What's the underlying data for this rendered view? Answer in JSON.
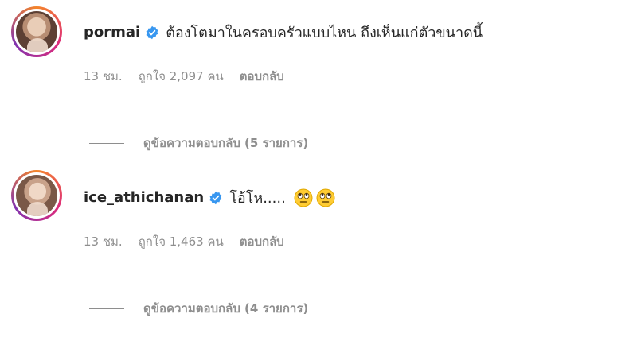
{
  "comments": [
    {
      "username": "pormai",
      "text": "ต้องโตมาในครอบครัวแบบไหน ถึงเห็นแก่ตัวขนาดนี้",
      "time": "13 ชม.",
      "likes": "ถูกใจ 2,097 คน",
      "reply": "ตอบกลับ",
      "view_replies": "ดูข้อความตอบกลับ (5 รายการ)"
    },
    {
      "username": "ice_athichanan",
      "text": "โอ้โห.....",
      "emojis": [
        "face-with-rolling-eyes",
        "face-with-rolling-eyes"
      ],
      "time": "13 ชม.",
      "likes": "ถูกใจ 1,463 คน",
      "reply": "ตอบกลับ",
      "view_replies": "ดูข้อความตอบกลับ (4 รายการ)"
    }
  ],
  "colors": {
    "verified": "#3897f0",
    "secondary_text": "#8e8e8e",
    "primary_text": "#262626"
  }
}
